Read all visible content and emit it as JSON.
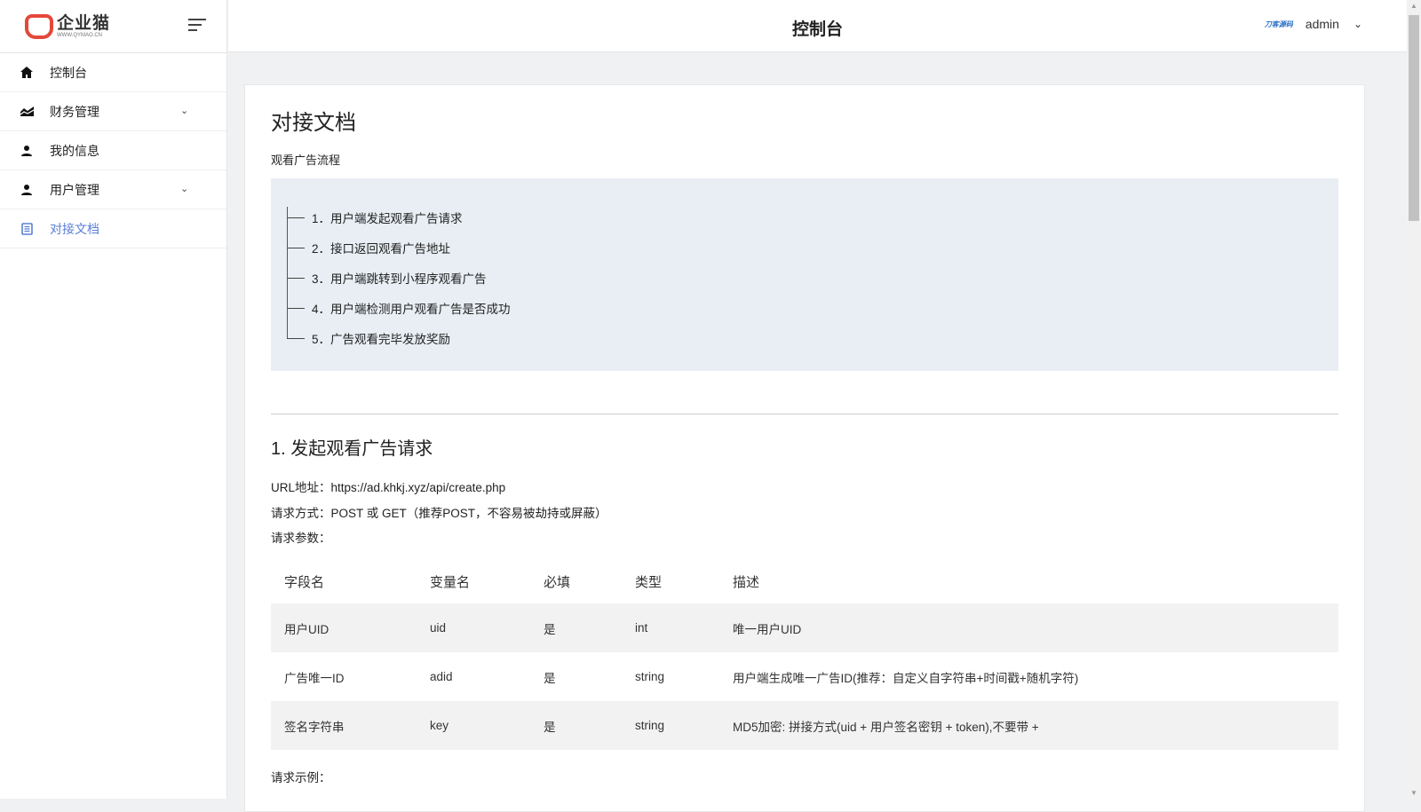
{
  "logo": {
    "name": "企业猫",
    "domain": "WWW.QYMAO.CN"
  },
  "sidebar": {
    "items": [
      {
        "label": "控制台",
        "icon": "home-icon"
      },
      {
        "label": "财务管理",
        "icon": "chart-area-icon",
        "expandable": true
      },
      {
        "label": "我的信息",
        "icon": "user-icon"
      },
      {
        "label": "用户管理",
        "icon": "user-icon",
        "expandable": true
      },
      {
        "label": "对接文档",
        "icon": "document-icon",
        "active": true
      }
    ]
  },
  "header": {
    "title": "控制台",
    "brand": "刀客源码",
    "user": "admin"
  },
  "main": {
    "title": "对接文档",
    "flow_title": "观看广告流程",
    "flow": [
      "1．用户端发起观看广告请求",
      "2．接口返回观看广告地址",
      "3．用户端跳转到小程序观看广告",
      "4．用户端检测用户观看广告是否成功",
      "5．广告观看完毕发放奖励"
    ],
    "section1": {
      "title": "1. 发起观看广告请求",
      "url": "URL地址：https://ad.khkj.xyz/api/create.php",
      "method": "请求方式：POST 或 GET（推荐POST，不容易被劫持或屏蔽）",
      "params_label": "请求参数：",
      "headers": [
        "字段名",
        "变量名",
        "必填",
        "类型",
        "描述"
      ],
      "rows": [
        [
          "用户UID",
          "uid",
          "是",
          "int",
          "唯一用户UID"
        ],
        [
          "广告唯一ID",
          "adid",
          "是",
          "string",
          "用户端生成唯一广告ID(推荐：自定义自字符串+时间戳+随机字符)"
        ],
        [
          "签名字符串",
          "key",
          "是",
          "string",
          "MD5加密: 拼接方式(uid + 用户签名密钥 + token),不要带 +"
        ]
      ],
      "example_label": "请求示例："
    }
  }
}
